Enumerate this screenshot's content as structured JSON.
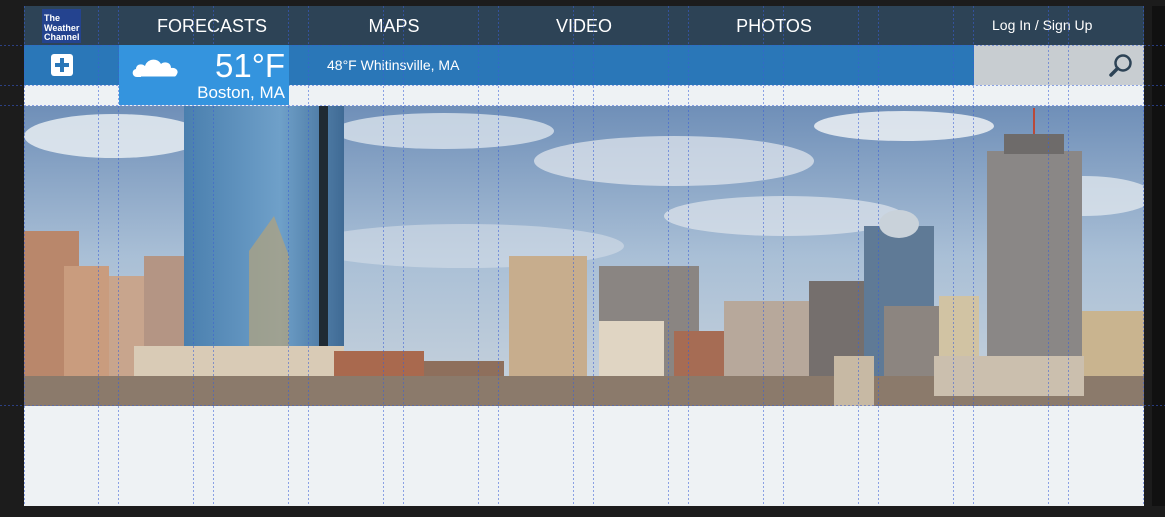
{
  "logo": {
    "line1": "The",
    "line2": "Weather",
    "line3": "Channel"
  },
  "nav": {
    "forecasts": "FORECASTS",
    "maps": "MAPS",
    "video": "VIDEO",
    "photos": "PHOTOS",
    "login": "Log In / Sign Up"
  },
  "weather": {
    "condition_icon": "cloud-icon",
    "temperature": "51°F",
    "city": "Boston, MA",
    "secondary": "48°F Whitinsville, MA"
  },
  "hero": {
    "subject": "Boston skyline photo"
  },
  "colors": {
    "nav_bg": "#2d4356",
    "weather_bar": "#2a77b8",
    "current_tile": "#3494de",
    "logo_bg": "#24438f",
    "search_bg": "#c8cdd1"
  }
}
